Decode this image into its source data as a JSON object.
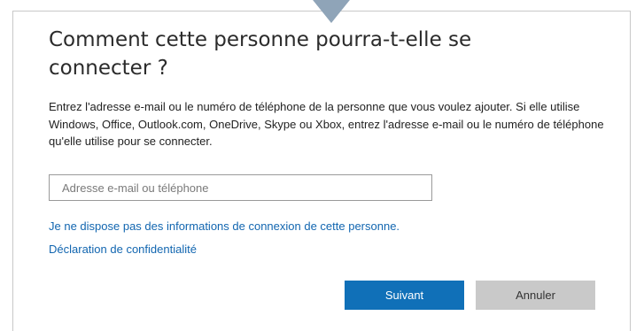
{
  "dialog": {
    "title": "Comment cette personne pourra-t-elle se connecter ?",
    "description": "Entrez l'adresse e-mail ou le numéro de téléphone de la personne que vous voulez ajouter. Si elle utilise Windows, Office, Outlook.com, OneDrive, Skype ou Xbox, entrez l'adresse e-mail ou le numéro de téléphone qu'elle utilise pour se connecter.",
    "email_input": {
      "value": "",
      "placeholder": "Adresse e-mail ou téléphone"
    },
    "links": {
      "no_info": "Je ne dispose pas des informations de connexion de cette personne.",
      "privacy": "Déclaration de confidentialité"
    },
    "buttons": {
      "next": "Suivant",
      "cancel": "Annuler"
    }
  },
  "callout": {
    "color": "#8fa4b8",
    "text_color": "#ffffff"
  },
  "colors": {
    "accent": "#1070b8",
    "link": "#1266b0",
    "cancel_bg": "#c9c9c9"
  }
}
